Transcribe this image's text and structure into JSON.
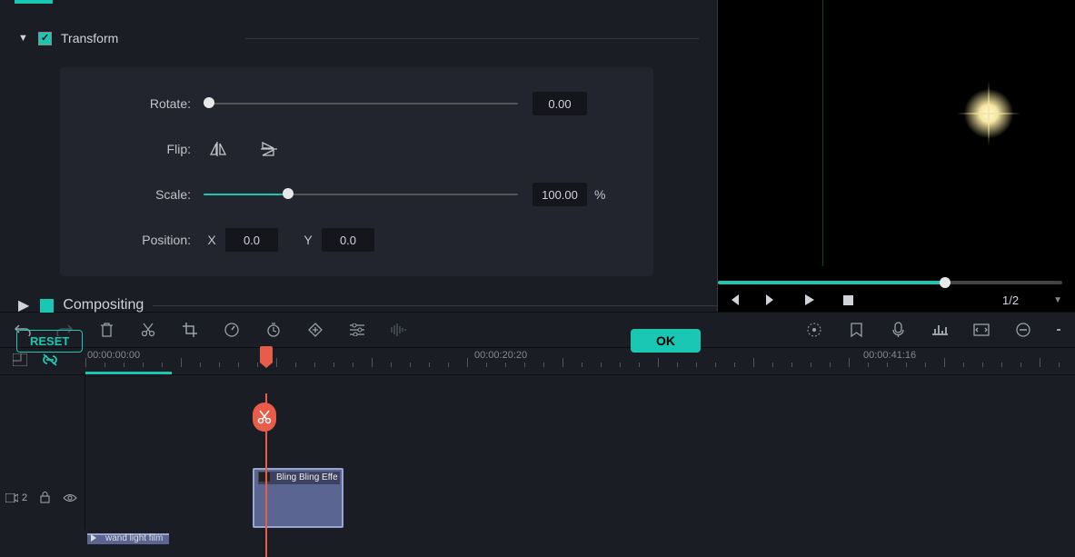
{
  "inspector": {
    "transform": {
      "title": "Transform",
      "checked": true,
      "rotate_label": "Rotate:",
      "rotate_value": "0.00",
      "flip_label": "Flip:",
      "scale_label": "Scale:",
      "scale_value": "100.00",
      "scale_unit": "%",
      "position_label": "Position:",
      "pos_x_lbl": "X",
      "pos_x_val": "0.0",
      "pos_y_lbl": "Y",
      "pos_y_val": "0.0"
    },
    "compositing": {
      "title": "Compositing",
      "checked": true
    },
    "reset_label": "RESET",
    "ok_label": "OK"
  },
  "preview": {
    "frame_indicator": "1/2"
  },
  "timeline": {
    "ruler": [
      "00:00:00:00",
      "00:00:20:20",
      "00:00:41:16"
    ],
    "track2_badge": "2",
    "clips": {
      "effect": "Bling Bling Effe",
      "base": "wand light film"
    }
  }
}
